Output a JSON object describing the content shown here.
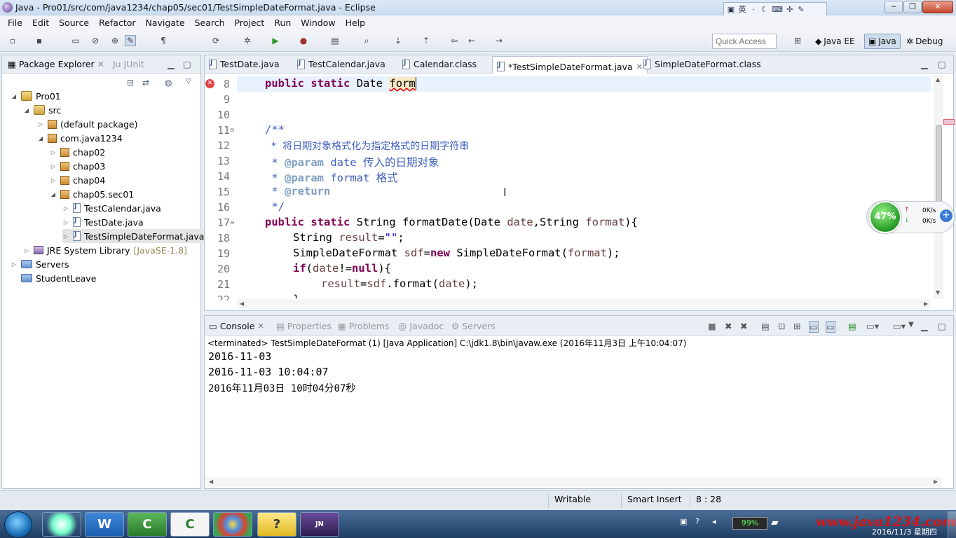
{
  "window": {
    "title": "Java - Pro01/src/com/java1234/chap05/sec01/TestSimpleDateFormat.java - Eclipse",
    "min": "─",
    "max": "❐",
    "close": "✕"
  },
  "ime": {
    "mode": "英",
    "i1": "·",
    "i2": "☾",
    "i3": "⌨",
    "i4": "✢",
    "i5": "✎"
  },
  "menu": [
    "File",
    "Edit",
    "Source",
    "Refactor",
    "Navigate",
    "Search",
    "Project",
    "Run",
    "Window",
    "Help"
  ],
  "toolbar": {
    "quick_access_placeholder": "Quick Access",
    "perspectives": [
      {
        "label": "Java EE"
      },
      {
        "label": "Java"
      },
      {
        "label": "Debug"
      }
    ]
  },
  "package_explorer": {
    "tab_label": "Package Explorer",
    "junit_label": "JUnit",
    "tree": [
      {
        "label": "Pro01"
      },
      {
        "label": "src"
      },
      {
        "label": "(default package)"
      },
      {
        "label": "com.java1234"
      },
      {
        "label": "chap02"
      },
      {
        "label": "chap03"
      },
      {
        "label": "chap04"
      },
      {
        "label": "chap05.sec01"
      },
      {
        "label": "TestCalendar.java"
      },
      {
        "label": "TestDate.java"
      },
      {
        "label": "TestSimpleDateFormat.java"
      },
      {
        "label": "JRE System Library",
        "extra": "[JavaSE-1.8]"
      },
      {
        "label": "Servers"
      },
      {
        "label": "StudentLeave"
      }
    ]
  },
  "editor": {
    "tabs": [
      {
        "label": "TestDate.java"
      },
      {
        "label": "TestCalendar.java"
      },
      {
        "label": "Calendar.class"
      },
      {
        "label": "*TestSimpleDateFormat.java"
      },
      {
        "label": "SimpleDateFormat.class"
      }
    ],
    "line_numbers": [
      "8",
      "9",
      "10",
      "11",
      "12",
      "13",
      "14",
      "15",
      "16",
      "17",
      "18",
      "19",
      "20",
      "21",
      "22"
    ],
    "line8": {
      "kw1": "public",
      "kw2": "static",
      "type": "Date",
      "ident": "form"
    },
    "line11": "/**",
    "line12": " * 将日期对象格式化为指定格式的日期字符串",
    "line13": {
      "star": " * ",
      "tag": "@param",
      "rest": " date 传入的日期对象"
    },
    "line14": {
      "star": " * ",
      "tag": "@param",
      "rest": " format 格式"
    },
    "line15": {
      "star": " * ",
      "tag": "@return"
    },
    "line16": " */",
    "line17": {
      "kw1": "public",
      "kw2": "static",
      "rest1": " String formatDate(Date ",
      "p1": "date",
      "rest2": ",String ",
      "p2": "format",
      "rest3": "){"
    },
    "line18": {
      "a": "String ",
      "v": "result",
      "b": "=",
      "s": "\"\"",
      "c": ";"
    },
    "line19": {
      "a": "SimpleDateFormat ",
      "v": "sdf",
      "b": "=",
      "kw": "new",
      "c": " SimpleDateFormat(",
      "p": "format",
      "d": ");"
    },
    "line20": {
      "kw": "if",
      "a": "(",
      "p": "date",
      "b": "!=",
      "kw2": "null",
      "c": "){"
    },
    "line21": {
      "v": "result",
      "a": "=",
      "v2": "sdf",
      "b": ".format(",
      "p": "date",
      "c": ");"
    },
    "line22": "}"
  },
  "console": {
    "tabs": [
      {
        "label": "Console"
      },
      {
        "label": "Properties"
      },
      {
        "label": "Problems"
      },
      {
        "label": "Javadoc"
      },
      {
        "label": "Servers"
      }
    ],
    "terminated": "<terminated> TestSimpleDateFormat (1) [Java Application] C:\\jdk1.8\\bin\\javaw.exe (2016年11月3日 上午10:04:07)",
    "output": [
      "2016-11-03",
      "2016-11-03 10:04:07",
      "2016年11月03日 10时04分07秒"
    ]
  },
  "status": {
    "writable": "Writable",
    "insert": "Smart Insert",
    "position": "8 : 28"
  },
  "net_widget": {
    "percent": "47%",
    "up": "0K/s",
    "down": "0K/s"
  },
  "taskbar": {
    "battery": "99%",
    "date": "2016/11/3 星期四",
    "watermark": "www.java1234.com",
    "buttons": [
      "W",
      "C",
      "C",
      "?",
      "JN"
    ]
  },
  "colors": {
    "keyword": "#7f0055",
    "comment": "#3f5fbf",
    "field": "#6a3e3e",
    "string": "#2a00ff"
  }
}
